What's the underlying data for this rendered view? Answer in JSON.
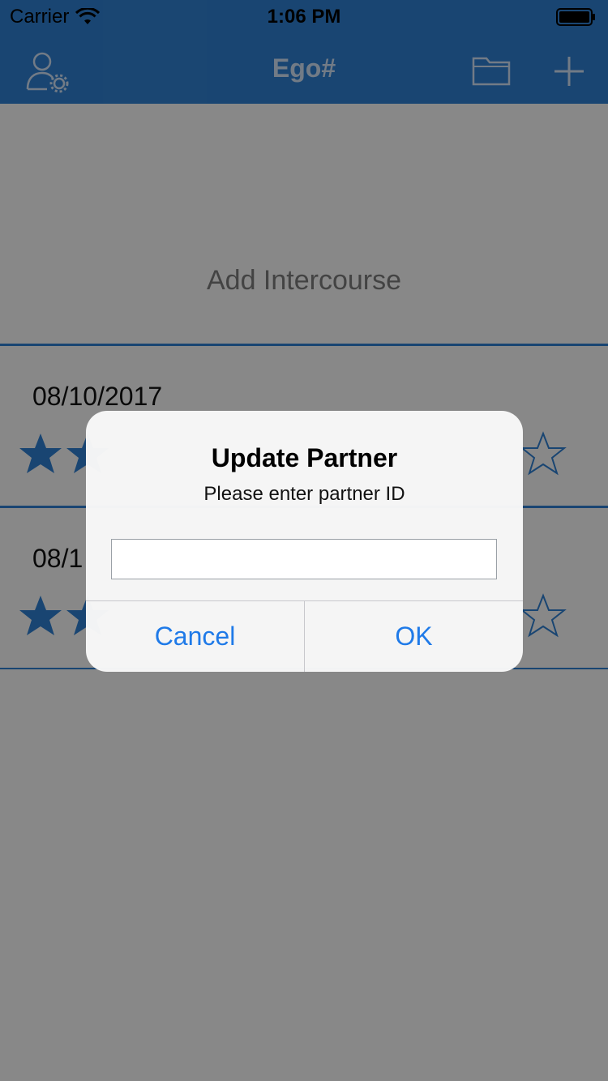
{
  "status_bar": {
    "carrier": "Carrier",
    "time": "1:06 PM"
  },
  "navbar": {
    "title": "Ego#",
    "icons": [
      "user-settings-icon",
      "folder-icon",
      "plus-icon"
    ]
  },
  "add_section": {
    "label": "Add Intercourse"
  },
  "entries": [
    {
      "date": "08/10/2017",
      "rating": 2,
      "max": 5
    },
    {
      "date": "08/1",
      "rating": 2,
      "max": 5
    }
  ],
  "alert": {
    "title": "Update Partner",
    "message": "Please enter partner ID",
    "input_value": "",
    "cancel_label": "Cancel",
    "ok_label": "OK"
  },
  "colors": {
    "header": "#2f7fd0",
    "accent": "#2f7fd0",
    "button_text": "#1f7ae8"
  }
}
